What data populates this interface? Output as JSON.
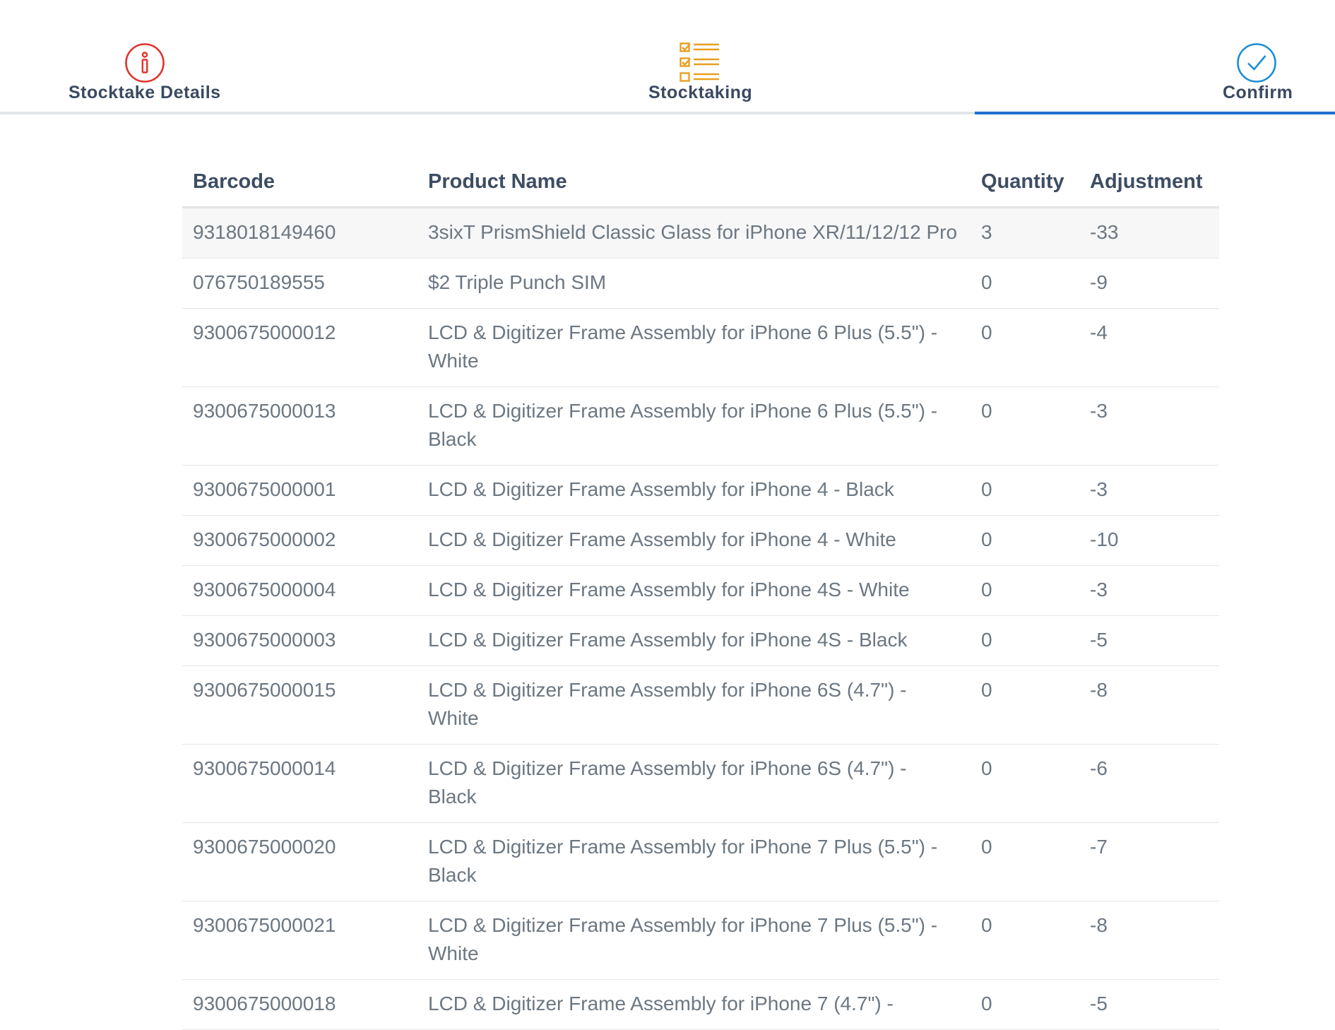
{
  "tabs": {
    "details_label": "Stocktake Details",
    "stocktaking_label": "Stocktaking",
    "confirm_label": "Confirm"
  },
  "colors": {
    "details_icon": "#e0332c",
    "stocktaking_icon": "#e8a020",
    "confirm_icon": "#1a8ed1",
    "active_tab": "#1f6fd0"
  },
  "table": {
    "headers": {
      "barcode": "Barcode",
      "product_name": "Product Name",
      "quantity": "Quantity",
      "adjustment": "Adjustment"
    },
    "rows": [
      {
        "barcode": "9318018149460",
        "name": "3sixT PrismShield Classic Glass for iPhone XR/11/12/12 Pro",
        "quantity": "3",
        "adjustment": "-33"
      },
      {
        "barcode": "076750189555",
        "name": "$2 Triple Punch SIM",
        "quantity": "0",
        "adjustment": "-9"
      },
      {
        "barcode": "9300675000012",
        "name": "LCD & Digitizer Frame Assembly for iPhone 6 Plus (5.5\") - White",
        "quantity": "0",
        "adjustment": "-4"
      },
      {
        "barcode": "9300675000013",
        "name": "LCD & Digitizer Frame Assembly for iPhone 6 Plus (5.5\") - Black",
        "quantity": "0",
        "adjustment": "-3"
      },
      {
        "barcode": "9300675000001",
        "name": "LCD & Digitizer Frame Assembly for iPhone 4 - Black",
        "quantity": "0",
        "adjustment": "-3"
      },
      {
        "barcode": "9300675000002",
        "name": "LCD & Digitizer Frame Assembly for iPhone 4 - White",
        "quantity": "0",
        "adjustment": "-10"
      },
      {
        "barcode": "9300675000004",
        "name": "LCD & Digitizer Frame Assembly for iPhone 4S - White",
        "quantity": "0",
        "adjustment": "-3"
      },
      {
        "barcode": "9300675000003",
        "name": "LCD & Digitizer Frame Assembly for iPhone 4S - Black",
        "quantity": "0",
        "adjustment": "-5"
      },
      {
        "barcode": "9300675000015",
        "name": "LCD & Digitizer Frame Assembly for iPhone 6S (4.7\") - White",
        "quantity": "0",
        "adjustment": "-8"
      },
      {
        "barcode": "9300675000014",
        "name": "LCD & Digitizer Frame Assembly for iPhone 6S (4.7\") - Black",
        "quantity": "0",
        "adjustment": "-6"
      },
      {
        "barcode": "9300675000020",
        "name": "LCD & Digitizer Frame Assembly for iPhone 7 Plus (5.5\") - Black",
        "quantity": "0",
        "adjustment": "-7"
      },
      {
        "barcode": "9300675000021",
        "name": "LCD & Digitizer Frame Assembly for iPhone 7 Plus (5.5\") - White",
        "quantity": "0",
        "adjustment": "-8"
      },
      {
        "barcode": "9300675000018",
        "name": "LCD & Digitizer Frame Assembly for iPhone 7 (4.7\") -",
        "quantity": "0",
        "adjustment": "-5"
      }
    ]
  }
}
